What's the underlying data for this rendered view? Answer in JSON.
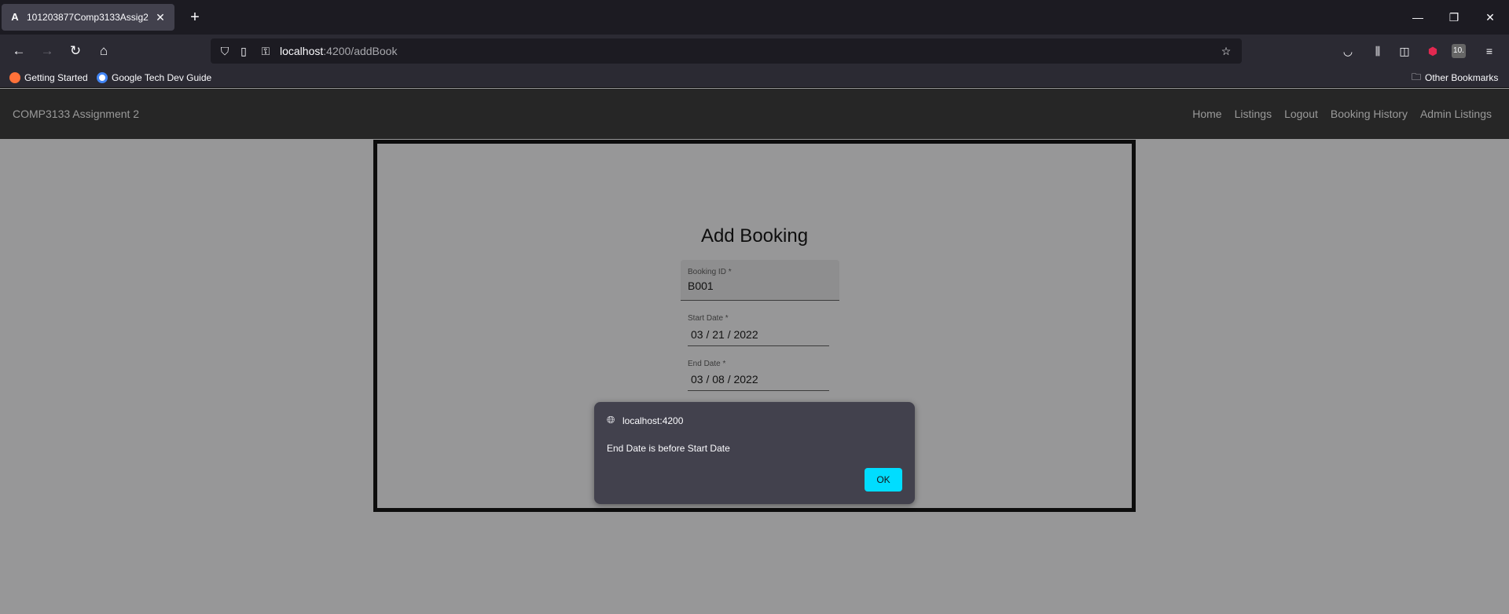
{
  "browser": {
    "tab_title": "101203877Comp3133Assig2",
    "tab_favicon": "angular-logo-icon",
    "url_host": "localhost",
    "url_path": ":4200/addBook",
    "bookmarks": [
      "Getting Started",
      "Google Tech Dev Guide"
    ],
    "other_bookmarks": "Other Bookmarks",
    "extension_badge": "10."
  },
  "app": {
    "brand": "COMP3133 Assignment 2",
    "nav": [
      "Home",
      "Listings",
      "Logout",
      "Booking History",
      "Admin Listings"
    ]
  },
  "form": {
    "title": "Add Booking",
    "booking_id_label": "Booking ID *",
    "booking_id_value": "B001",
    "start_date_label": "Start Date *",
    "start_date_value": "03 / 21 / 2022",
    "end_date_label": "End Date *",
    "end_date_value": "03 / 08 / 2022"
  },
  "dialog": {
    "origin": "localhost:4200",
    "message": "End Date is before Start Date",
    "ok_label": "OK"
  },
  "colors": {
    "overlay_page": "#979798",
    "dialog_bg": "#42414d",
    "ok_button": "#00ddff"
  }
}
